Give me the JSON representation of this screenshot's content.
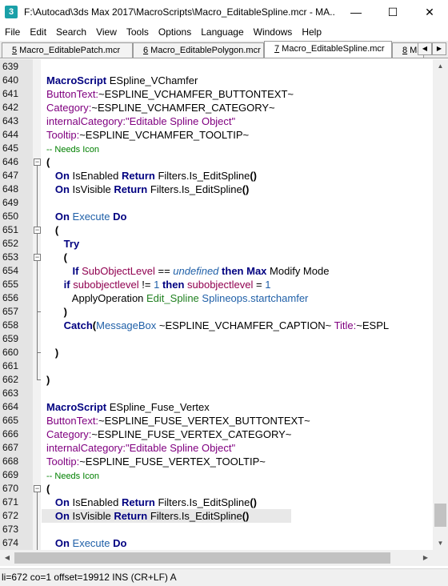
{
  "window": {
    "title": "F:\\Autocad\\3ds Max 2017\\MacroScripts\\Macro_EditableSpline.mcr - MA...",
    "app_icon_glyph": "3",
    "controls": {
      "minimize": "—",
      "maximize": "☐",
      "close": "✕"
    }
  },
  "menu": [
    "File",
    "Edit",
    "Search",
    "View",
    "Tools",
    "Options",
    "Language",
    "Windows",
    "Help"
  ],
  "tabs": [
    {
      "num": "5",
      "label": " Macro_EditablePatch.mcr"
    },
    {
      "num": "6",
      "label": " Macro_EditablePolygon.mcr"
    },
    {
      "num": "7",
      "label": " Macro_EditableSpline.mcr"
    },
    {
      "num": "8",
      "label": " Ma"
    }
  ],
  "tab_scroll": {
    "left": "◀",
    "right": "▶"
  },
  "editor": {
    "lines": [
      {
        "num": "639",
        "tokens": []
      },
      {
        "num": "640",
        "tokens": [
          {
            "t": "MacroScript",
            "c": "kw"
          },
          {
            "t": " ESpline_VChamfer",
            "c": ""
          }
        ]
      },
      {
        "num": "641",
        "tokens": [
          {
            "t": "ButtonText:",
            "c": "gr"
          },
          {
            "t": "~ESPLINE_VCHAMFER_BUTTONTEXT~",
            "c": ""
          }
        ]
      },
      {
        "num": "642",
        "tokens": [
          {
            "t": "Category:",
            "c": "gr"
          },
          {
            "t": "~ESPLINE_VCHAMFER_CATEGORY~",
            "c": ""
          }
        ]
      },
      {
        "num": "643",
        "tokens": [
          {
            "t": "internalCategory:",
            "c": "gr"
          },
          {
            "t": "\"Editable Spline Object\"",
            "c": "str"
          }
        ]
      },
      {
        "num": "644",
        "tokens": [
          {
            "t": "Tooltip:",
            "c": "gr"
          },
          {
            "t": "~ESPLINE_VCHAMFER_TOOLTIP~",
            "c": ""
          }
        ]
      },
      {
        "num": "645",
        "tokens": [
          {
            "t": "-- Needs Icon",
            "c": "cm"
          }
        ]
      },
      {
        "num": "646",
        "tokens": [
          {
            "t": "(",
            "c": "br"
          }
        ]
      },
      {
        "num": "647",
        "tokens": [
          {
            "t": "   "
          },
          {
            "t": "On",
            "c": "kw"
          },
          {
            "t": " IsEnabled ",
            "c": ""
          },
          {
            "t": "Return",
            "c": "kw"
          },
          {
            "t": " Filters.Is_EditSpline",
            "c": ""
          },
          {
            "t": "()",
            "c": "br"
          }
        ]
      },
      {
        "num": "648",
        "tokens": [
          {
            "t": "   "
          },
          {
            "t": "On",
            "c": "kw"
          },
          {
            "t": " IsVisible ",
            "c": ""
          },
          {
            "t": "Return",
            "c": "kw"
          },
          {
            "t": " Filters.Is_EditSpline",
            "c": ""
          },
          {
            "t": "()",
            "c": "br"
          }
        ]
      },
      {
        "num": "649",
        "tokens": []
      },
      {
        "num": "650",
        "tokens": [
          {
            "t": "   "
          },
          {
            "t": "On",
            "c": "kw"
          },
          {
            "t": " "
          },
          {
            "t": "Execute",
            "c": "fn"
          },
          {
            "t": " "
          },
          {
            "t": "Do",
            "c": "kw"
          }
        ]
      },
      {
        "num": "651",
        "tokens": [
          {
            "t": "   "
          },
          {
            "t": "(",
            "c": "br"
          }
        ]
      },
      {
        "num": "652",
        "tokens": [
          {
            "t": "      "
          },
          {
            "t": "Try",
            "c": "kw"
          }
        ]
      },
      {
        "num": "653",
        "tokens": [
          {
            "t": "      "
          },
          {
            "t": "(",
            "c": "br"
          }
        ]
      },
      {
        "num": "654",
        "tokens": [
          {
            "t": "         "
          },
          {
            "t": "If",
            "c": "kw"
          },
          {
            "t": " "
          },
          {
            "t": "SubObjectLevel",
            "c": "red"
          },
          {
            "t": " == "
          },
          {
            "t": "undefined",
            "c": "udf"
          },
          {
            "t": " "
          },
          {
            "t": "then",
            "c": "kw"
          },
          {
            "t": " "
          },
          {
            "t": "Max",
            "c": "kw"
          },
          {
            "t": " Modify Mode"
          }
        ]
      },
      {
        "num": "655",
        "tokens": [
          {
            "t": "      "
          },
          {
            "t": "if",
            "c": "kw"
          },
          {
            "t": " "
          },
          {
            "t": "subobjectlevel",
            "c": "red"
          },
          {
            "t": " != "
          },
          {
            "t": "1",
            "c": "fn"
          },
          {
            "t": " "
          },
          {
            "t": "then",
            "c": "kw"
          },
          {
            "t": " "
          },
          {
            "t": "subobjectlevel",
            "c": "red"
          },
          {
            "t": " = "
          },
          {
            "t": "1",
            "c": "fn"
          }
        ]
      },
      {
        "num": "656",
        "tokens": [
          {
            "t": "         ApplyOperation "
          },
          {
            "t": "Edit_Spline",
            "c": "grn"
          },
          {
            "t": " "
          },
          {
            "t": "Splineops.startchamfer",
            "c": "fn"
          }
        ]
      },
      {
        "num": "657",
        "tokens": [
          {
            "t": "      "
          },
          {
            "t": ")",
            "c": "br"
          }
        ]
      },
      {
        "num": "658",
        "tokens": [
          {
            "t": "      "
          },
          {
            "t": "Catch",
            "c": "kw"
          },
          {
            "t": "(",
            "c": "br"
          },
          {
            "t": "MessageBox",
            "c": "fn"
          },
          {
            "t": " ~ESPLINE_VCHAMFER_CAPTION~ "
          },
          {
            "t": "Title:",
            "c": "gr"
          },
          {
            "t": "~ESPL"
          }
        ]
      },
      {
        "num": "659",
        "tokens": []
      },
      {
        "num": "660",
        "tokens": [
          {
            "t": "   "
          },
          {
            "t": ")",
            "c": "br"
          }
        ]
      },
      {
        "num": "661",
        "tokens": []
      },
      {
        "num": "662",
        "tokens": [
          {
            "t": ")",
            "c": "br"
          }
        ]
      },
      {
        "num": "663",
        "tokens": []
      },
      {
        "num": "664",
        "tokens": [
          {
            "t": "MacroScript",
            "c": "kw"
          },
          {
            "t": " ESpline_Fuse_Vertex"
          }
        ]
      },
      {
        "num": "665",
        "tokens": [
          {
            "t": "ButtonText:",
            "c": "gr"
          },
          {
            "t": "~ESPLINE_FUSE_VERTEX_BUTTONTEXT~"
          }
        ]
      },
      {
        "num": "666",
        "tokens": [
          {
            "t": "Category:",
            "c": "gr"
          },
          {
            "t": "~ESPLINE_FUSE_VERTEX_CATEGORY~"
          }
        ]
      },
      {
        "num": "667",
        "tokens": [
          {
            "t": "internalCategory:",
            "c": "gr"
          },
          {
            "t": "\"Editable Spline Object\"",
            "c": "str"
          }
        ]
      },
      {
        "num": "668",
        "tokens": [
          {
            "t": "Tooltip:",
            "c": "gr"
          },
          {
            "t": "~ESPLINE_FUSE_VERTEX_TOOLTIP~"
          }
        ]
      },
      {
        "num": "669",
        "tokens": [
          {
            "t": "-- Needs Icon",
            "c": "cm"
          }
        ]
      },
      {
        "num": "670",
        "tokens": [
          {
            "t": "(",
            "c": "br"
          }
        ]
      },
      {
        "num": "671",
        "tokens": [
          {
            "t": "   "
          },
          {
            "t": "On",
            "c": "kw"
          },
          {
            "t": " IsEnabled "
          },
          {
            "t": "Return",
            "c": "kw"
          },
          {
            "t": " Filters.Is_EditSpline"
          },
          {
            "t": "()",
            "c": "br"
          }
        ]
      },
      {
        "num": "672",
        "tokens": [
          {
            "t": "   "
          },
          {
            "t": "On",
            "c": "kw"
          },
          {
            "t": " IsVisible "
          },
          {
            "t": "Return",
            "c": "kw"
          },
          {
            "t": " Filters.Is_EditSpline"
          },
          {
            "t": "()",
            "c": "br"
          }
        ]
      },
      {
        "num": "673",
        "tokens": []
      },
      {
        "num": "674",
        "tokens": [
          {
            "t": "   "
          },
          {
            "t": "On",
            "c": "kw"
          },
          {
            "t": " "
          },
          {
            "t": "Execute",
            "c": "fn"
          },
          {
            "t": " "
          },
          {
            "t": "Do",
            "c": "kw"
          }
        ]
      }
    ]
  },
  "scrollbars": {
    "up": "▲",
    "down": "▼",
    "left": "◀",
    "right": "▶"
  },
  "status": {
    "text": "li=672 co=1 offset=19912 INS (CR+LF) A"
  }
}
